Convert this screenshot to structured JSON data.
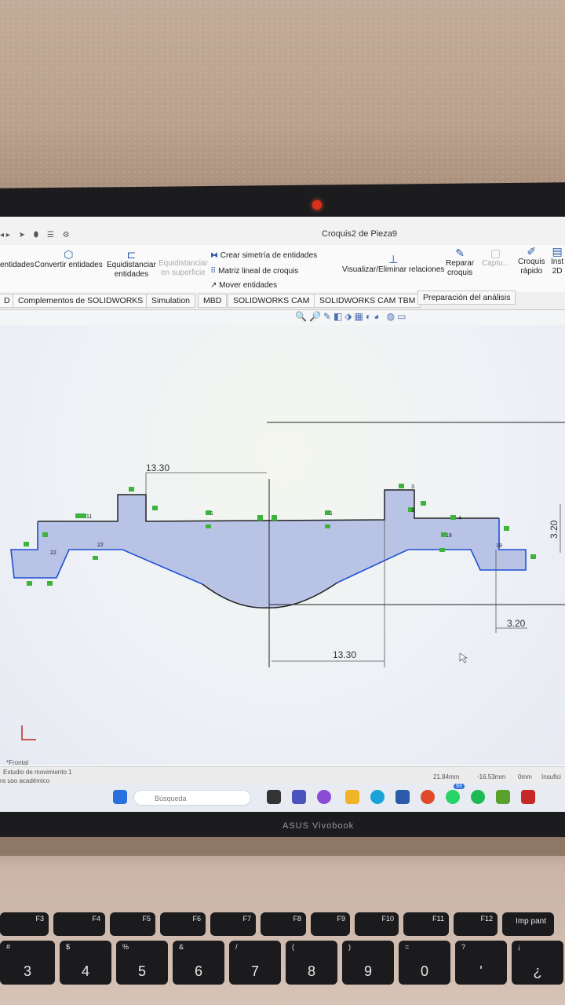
{
  "window": {
    "title": "Croquis2 de Pieza9"
  },
  "ribbon": {
    "entidades": "entidades",
    "convertir": "Convertir entidades",
    "equidistanciar": "Equidistanciar",
    "equidistanciar_line2": "entidades",
    "equid_superficie": "Equidistanciar",
    "equid_superficie_line2": "en superficie",
    "simetria": "Crear simetría de entidades",
    "matriz": "Matriz lineal de croquis",
    "mover": "Mover entidades",
    "relaciones": "Visualizar/Eliminar relaciones",
    "reparar": "Reparar",
    "reparar_line2": "croquis",
    "captura": "Captu...",
    "croquis_rapido": "Croquis",
    "croquis_rapido_line2": "rápido",
    "inst": "Inst",
    "inst_line2": "2D"
  },
  "tabs": [
    {
      "label": "D"
    },
    {
      "label": "Complementos de SOLIDWORKS"
    },
    {
      "label": "Simulation"
    },
    {
      "label": "MBD"
    },
    {
      "label": "SOLIDWORKS CAM"
    },
    {
      "label": "SOLIDWORKS CAM TBM"
    },
    {
      "label": "Preparación del análisis"
    }
  ],
  "sketch": {
    "dim_top": "13.30",
    "dim_bottom": "13.30",
    "dim_right_h": "3.20",
    "dim_right_v": "3.20",
    "rel_labels": [
      "11",
      "22",
      "22",
      "1",
      "1",
      "3",
      "3",
      "4",
      "18",
      "19"
    ]
  },
  "status": {
    "view": "*Frontal",
    "motion": "Estudio de movimiento 1",
    "license": "ra uso académico",
    "x": "21.84mm",
    "y": "-16.53mm",
    "z": "0mm",
    "state": "Insufici"
  },
  "taskbar": {
    "search_placeholder": "Búsqueda",
    "badge": "93"
  },
  "laptop": {
    "brand": "ASUS Vivobook"
  },
  "keys": [
    {
      "top": "F3",
      "main": ""
    },
    {
      "top": "F4",
      "main": ""
    },
    {
      "top": "F5",
      "main": ""
    },
    {
      "top": "F6",
      "main": ""
    },
    {
      "top": "F7",
      "main": ""
    },
    {
      "top": "F8",
      "main": ""
    },
    {
      "top": "F9",
      "main": ""
    },
    {
      "top": "F10",
      "main": ""
    },
    {
      "top": "F11",
      "main": ""
    },
    {
      "top": "F12",
      "main": ""
    },
    {
      "top": "",
      "main": "Imp pant"
    }
  ],
  "numkeys": [
    {
      "top": "#",
      "main": "3"
    },
    {
      "top": "$",
      "main": "4"
    },
    {
      "top": "%",
      "main": "5"
    },
    {
      "top": "&",
      "main": "6"
    },
    {
      "top": "/",
      "main": "7"
    },
    {
      "top": "(",
      "main": "8"
    },
    {
      "top": ")",
      "main": "9"
    },
    {
      "top": "=",
      "main": "0"
    },
    {
      "top": "?",
      "main": "'"
    },
    {
      "top": "¡",
      "main": "¿"
    }
  ],
  "colors": {
    "sketch_line": "#1f4fd6",
    "fill": "#b9c3e6",
    "dim": "#333333",
    "relation": "#3cb43c"
  }
}
